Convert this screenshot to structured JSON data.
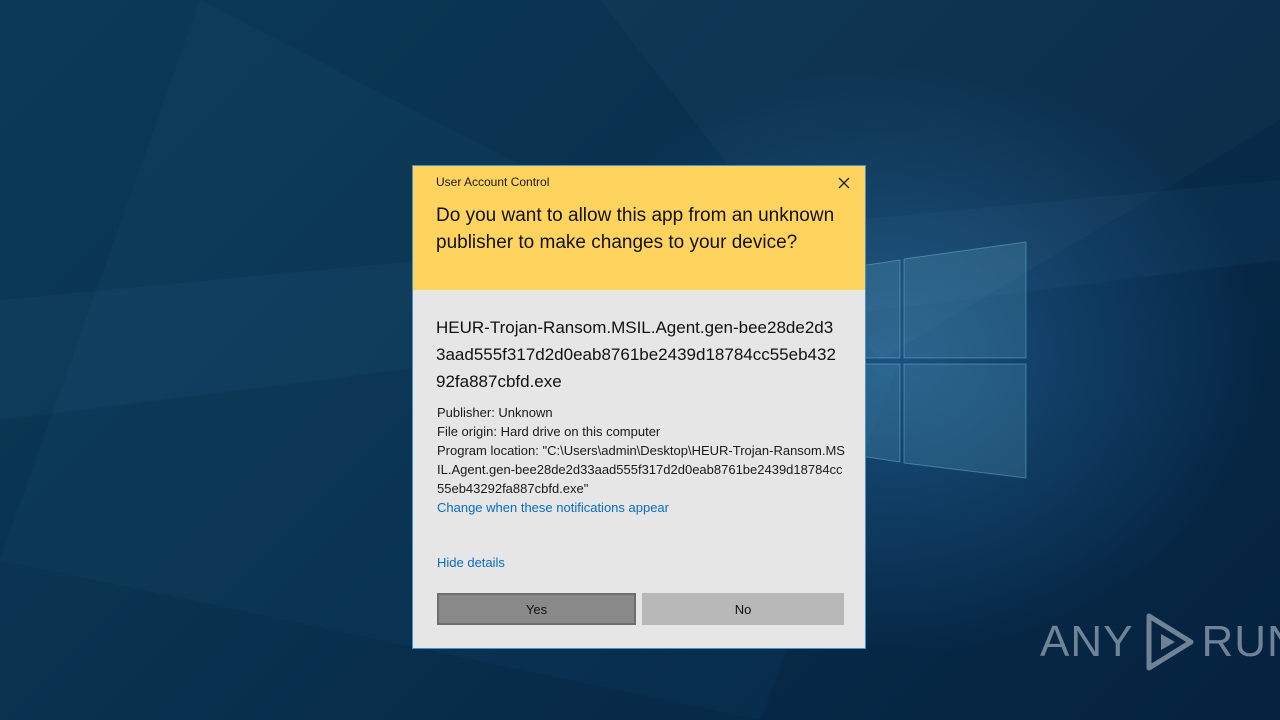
{
  "desktop": {
    "watermark_left": "ANY",
    "watermark_right": "RUN"
  },
  "dialog": {
    "title": "User Account Control",
    "question": "Do you want to allow this app from an unknown publisher to make changes to your device?",
    "app_name": "HEUR-Trojan-Ransom.MSIL.Agent.gen-bee28de2d33aad555f317d2d0eab8761be2439d18784cc55eb43292fa887cbfd.exe",
    "publisher": "Publisher: Unknown",
    "file_origin": "File origin: Hard drive on this computer",
    "program_location": "Program location: \"C:\\Users\\admin\\Desktop\\HEUR-Trojan-Ransom.MSIL.Agent.gen-bee28de2d33aad555f317d2d0eab8761be2439d18784cc55eb43292fa887cbfd.exe\"",
    "change_link": "Change when these notifications appear",
    "hide_details": "Hide details",
    "yes_label": "Yes",
    "no_label": "No"
  },
  "colors": {
    "header": "#ffd45e",
    "body": "#e6e6e6",
    "link": "#0a6cc2",
    "yes_button": "#898989",
    "no_button": "#b8b8b8"
  },
  "icons": [
    "close-icon",
    "windows-logo-icon",
    "anyrun-play-icon"
  ]
}
